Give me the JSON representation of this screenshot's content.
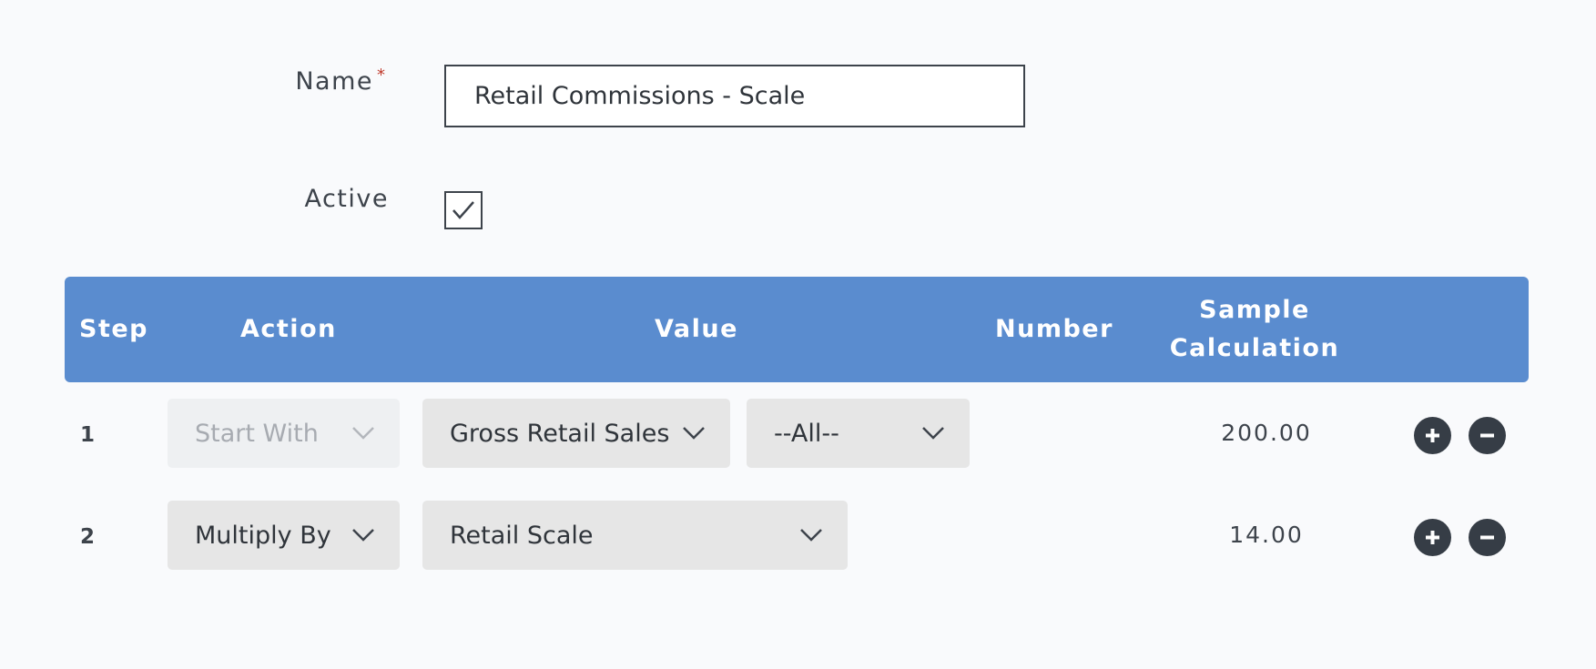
{
  "form": {
    "name_label": "Name",
    "required_marker": "*",
    "name_value": "Retail Commissions - Scale",
    "active_label": "Active",
    "active_checked": true
  },
  "table": {
    "headers": {
      "step": "Step",
      "action": "Action",
      "value": "Value",
      "number": "Number",
      "sample_line1": "Sample",
      "sample_line2": "Calculation"
    },
    "rows": [
      {
        "step": "1",
        "action": "Start With",
        "action_disabled": true,
        "value": "Gross Retail Sales",
        "value_filter": "--All--",
        "number": "",
        "sample": "200.00"
      },
      {
        "step": "2",
        "action": "Multiply By",
        "action_disabled": false,
        "value": "Retail Scale",
        "number": "",
        "sample": "14.00"
      }
    ]
  },
  "colors": {
    "header_bg": "#5a8ccf",
    "select_bg": "#e6e6e6",
    "select_disabled_bg": "#eef0f2",
    "button_dark": "#363d46",
    "required": "#c0392b"
  },
  "icons": {
    "check": "checkmark-icon",
    "chevron": "chevron-down-icon",
    "add": "plus-circle-icon",
    "remove": "minus-circle-icon"
  }
}
